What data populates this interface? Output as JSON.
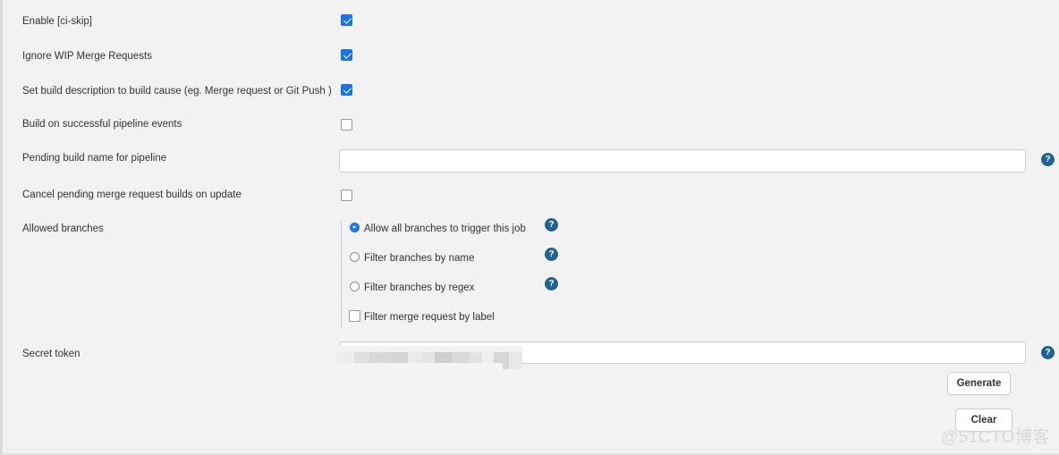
{
  "theme": {
    "panel_bg": "#f2f2f2",
    "accent_blue": "#1a73e8",
    "help_icon_blue": "#1f6393",
    "label_color": "#333333",
    "input_border": "#cfcfcf",
    "watermark_color": "#d9d9d9"
  },
  "form": {
    "rows": [
      {
        "label": "Enable [ci-skip]",
        "control": "checkbox",
        "checked": true
      },
      {
        "label": "Ignore WIP Merge Requests",
        "control": "checkbox",
        "checked": true
      },
      {
        "label": "Set build description to build cause (eg. Merge request or Git Push )",
        "control": "checkbox",
        "checked": true
      },
      {
        "label": "Build on successful pipeline events",
        "control": "checkbox",
        "checked": false
      },
      {
        "label": "Pending build name for pipeline",
        "control": "text",
        "value": "",
        "placeholder": "",
        "help": true
      },
      {
        "label": "Cancel pending merge request builds on update",
        "control": "checkbox",
        "checked": false
      },
      {
        "label": "Allowed branches",
        "control": "radio-group"
      },
      {
        "label": "Secret token",
        "control": "text",
        "value": "",
        "placeholder": "",
        "help": true,
        "redacted": true
      }
    ]
  },
  "allowed_branches": {
    "label": "Allowed branches",
    "options": [
      {
        "label": "Allow all branches to trigger this job",
        "type": "radio",
        "selected": true,
        "help": true
      },
      {
        "label": "Filter branches by name",
        "type": "radio",
        "selected": false,
        "help": true
      },
      {
        "label": "Filter branches by regex",
        "type": "radio",
        "selected": false,
        "help": true
      },
      {
        "label": "Filter merge request by label",
        "type": "checkbox",
        "selected": false,
        "help": false
      }
    ]
  },
  "secret_token": {
    "label": "Secret token",
    "value": "",
    "buttons": {
      "generate": "Generate",
      "clear": "Clear"
    }
  },
  "icons": {
    "help": "?"
  },
  "watermark": {
    "text": "@51CTO博客"
  }
}
